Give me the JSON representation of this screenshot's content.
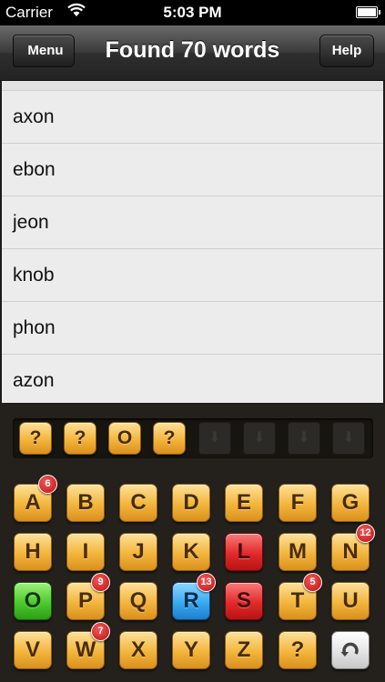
{
  "status_bar": {
    "carrier": "Carrier",
    "time": "5:03 PM"
  },
  "nav": {
    "back_label": "Menu",
    "title": "Found 70 words",
    "help_label": "Help"
  },
  "words": [
    "axon",
    "ebon",
    "jeon",
    "knob",
    "phon",
    "azon"
  ],
  "input_slots": [
    "?",
    "?",
    "O",
    "?"
  ],
  "empty_slot_icon": "down-arrow-icon",
  "letters": [
    {
      "char": "A",
      "color": "gold",
      "badge": "6"
    },
    {
      "char": "B",
      "color": "gold",
      "badge": ""
    },
    {
      "char": "C",
      "color": "gold",
      "badge": ""
    },
    {
      "char": "D",
      "color": "gold",
      "badge": ""
    },
    {
      "char": "E",
      "color": "gold",
      "badge": ""
    },
    {
      "char": "F",
      "color": "gold",
      "badge": ""
    },
    {
      "char": "G",
      "color": "gold",
      "badge": ""
    },
    {
      "char": "H",
      "color": "gold",
      "badge": ""
    },
    {
      "char": "I",
      "color": "gold",
      "badge": ""
    },
    {
      "char": "J",
      "color": "gold",
      "badge": ""
    },
    {
      "char": "K",
      "color": "gold",
      "badge": ""
    },
    {
      "char": "L",
      "color": "red",
      "badge": ""
    },
    {
      "char": "M",
      "color": "gold",
      "badge": ""
    },
    {
      "char": "N",
      "color": "gold",
      "badge": "12"
    },
    {
      "char": "O",
      "color": "green",
      "badge": ""
    },
    {
      "char": "P",
      "color": "gold",
      "badge": "9"
    },
    {
      "char": "Q",
      "color": "gold",
      "badge": ""
    },
    {
      "char": "R",
      "color": "blue",
      "badge": "13"
    },
    {
      "char": "S",
      "color": "red",
      "badge": ""
    },
    {
      "char": "T",
      "color": "gold",
      "badge": "5"
    },
    {
      "char": "U",
      "color": "gold",
      "badge": ""
    },
    {
      "char": "V",
      "color": "gold",
      "badge": ""
    },
    {
      "char": "W",
      "color": "gold",
      "badge": "7"
    },
    {
      "char": "X",
      "color": "gold",
      "badge": ""
    },
    {
      "char": "Y",
      "color": "gold",
      "badge": ""
    },
    {
      "char": "Z",
      "color": "gold",
      "badge": ""
    },
    {
      "char": "?",
      "color": "gold",
      "badge": ""
    }
  ],
  "reset_icon": "undo-icon",
  "colors": {
    "gold": "#f3b53c",
    "red": "#e22a2a",
    "green": "#4cc92e",
    "blue": "#39aaf0",
    "badge": "#c10f0f"
  }
}
